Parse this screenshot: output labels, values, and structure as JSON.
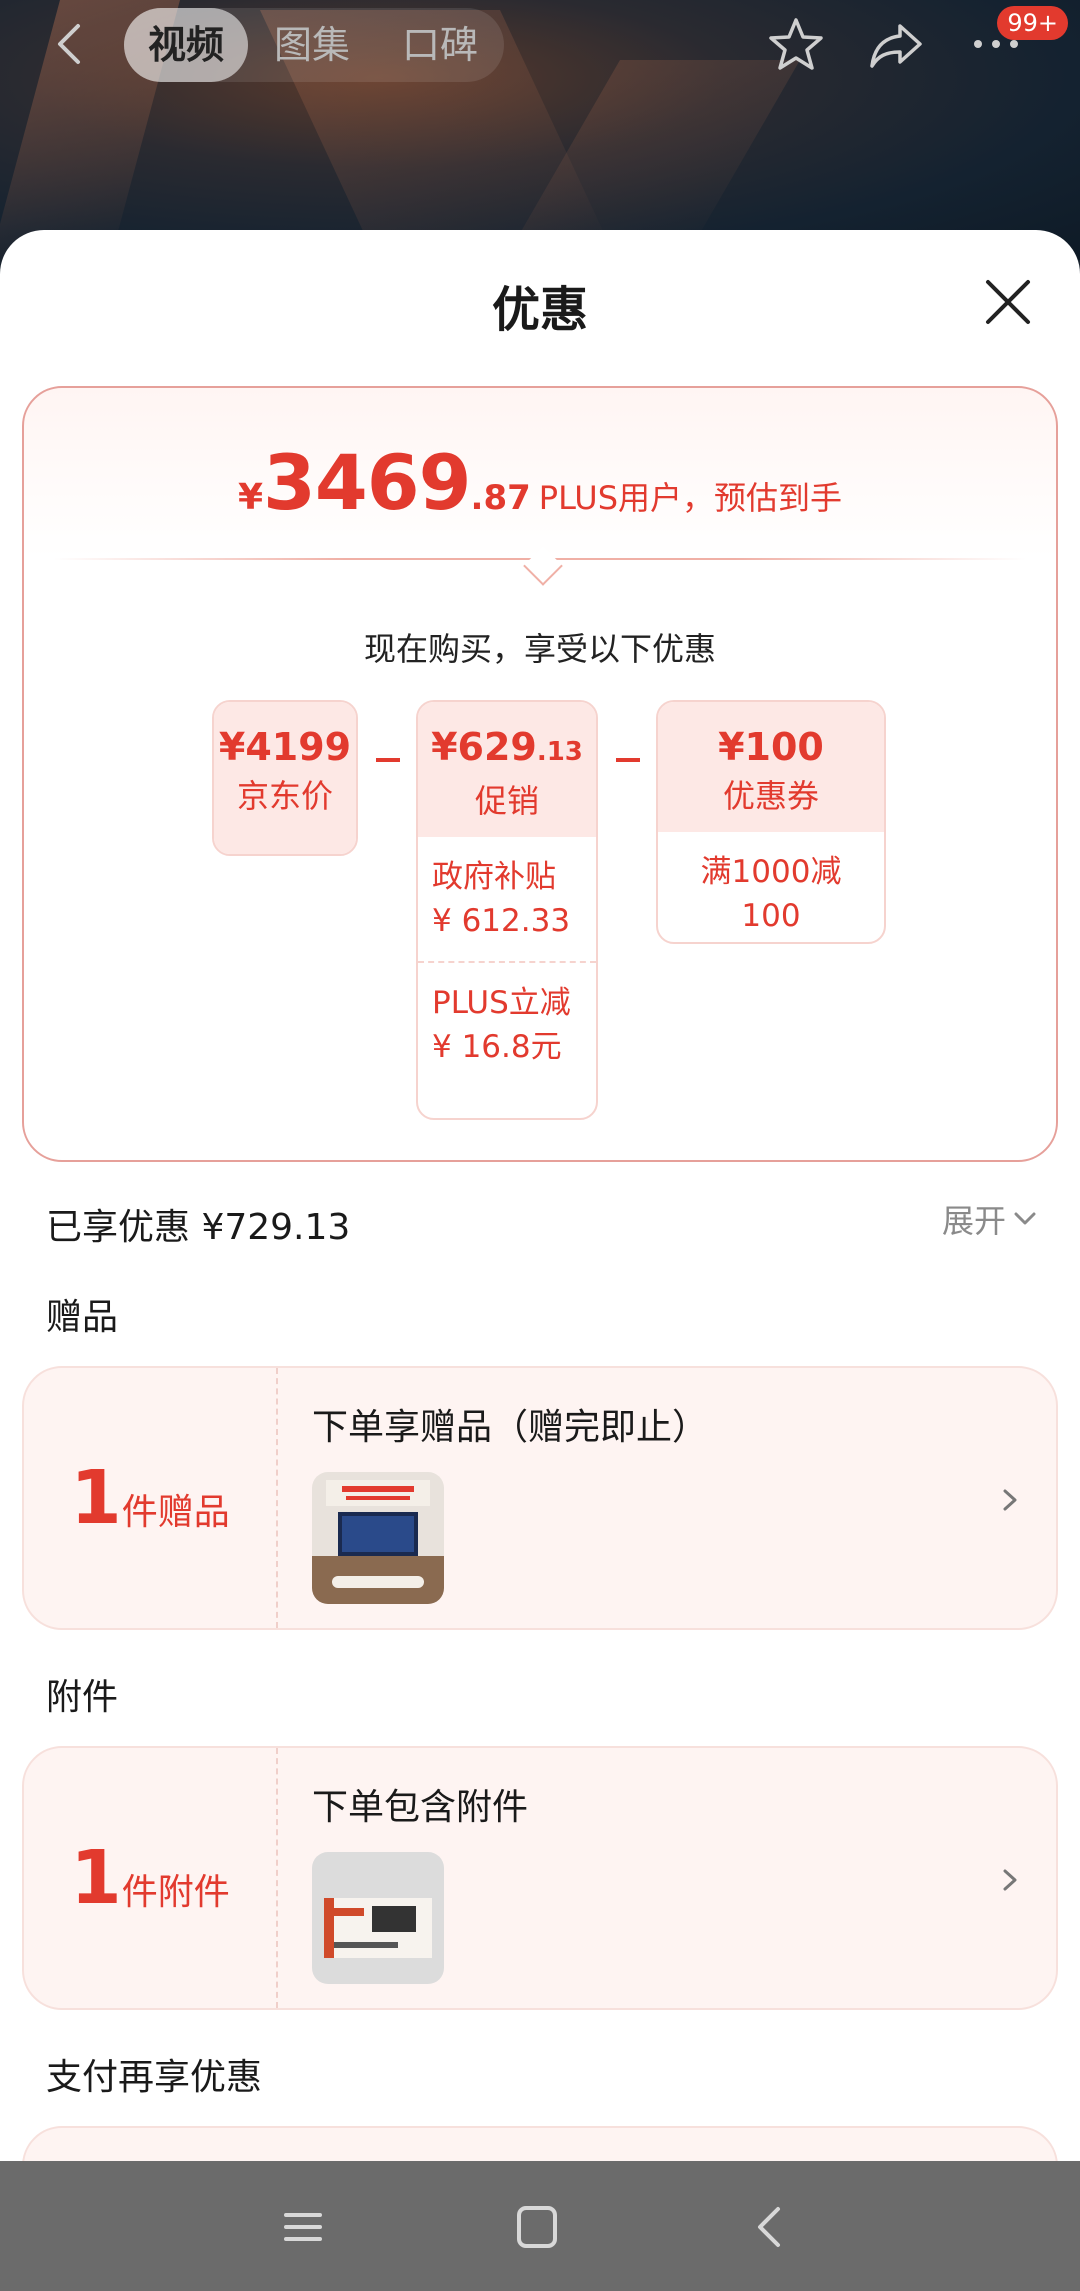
{
  "header": {
    "tabs": [
      {
        "label": "视频",
        "active": true
      },
      {
        "label": "图集",
        "active": false
      },
      {
        "label": "口碑",
        "active": false
      }
    ],
    "badge": "99+",
    "icons": [
      "back-icon",
      "star-icon",
      "share-icon",
      "more-icon"
    ]
  },
  "sheet": {
    "title": "优惠",
    "price": {
      "currency": "¥",
      "integer": "3469",
      "decimal": ".87",
      "note": "PLUS用户，预估到手"
    },
    "buy_now": "现在购买，享受以下优惠",
    "breakdown": {
      "jd_price": {
        "amount": "¥4199",
        "label": "京东价"
      },
      "promo": {
        "amount_int": "¥629",
        "amount_dec": ".13",
        "label": "促销",
        "items": [
          {
            "line1": "政府补贴",
            "line2": "¥ 612.33"
          },
          {
            "line1": "PLUS立减",
            "line2": "¥ 16.8元"
          }
        ]
      },
      "coupon": {
        "amount": "¥100",
        "label": "优惠券",
        "items": [
          {
            "line1": "满1000减100"
          }
        ]
      }
    },
    "saved": "已享优惠 ¥729.13",
    "expand": "展开",
    "gift_section": {
      "title": "赠品",
      "count": "1",
      "count_label": "件赠品",
      "desc": "下单享赠品（赠完即止）"
    },
    "accessory_section": {
      "title": "附件",
      "count": "1",
      "count_label": "件附件",
      "desc": "下单包含附件"
    },
    "pay_section": {
      "title": "支付再享优惠"
    }
  },
  "colors": {
    "accent": "#e23a2e",
    "card_bg": "#fef4f2",
    "nav_bar": "#6b6b6b"
  }
}
